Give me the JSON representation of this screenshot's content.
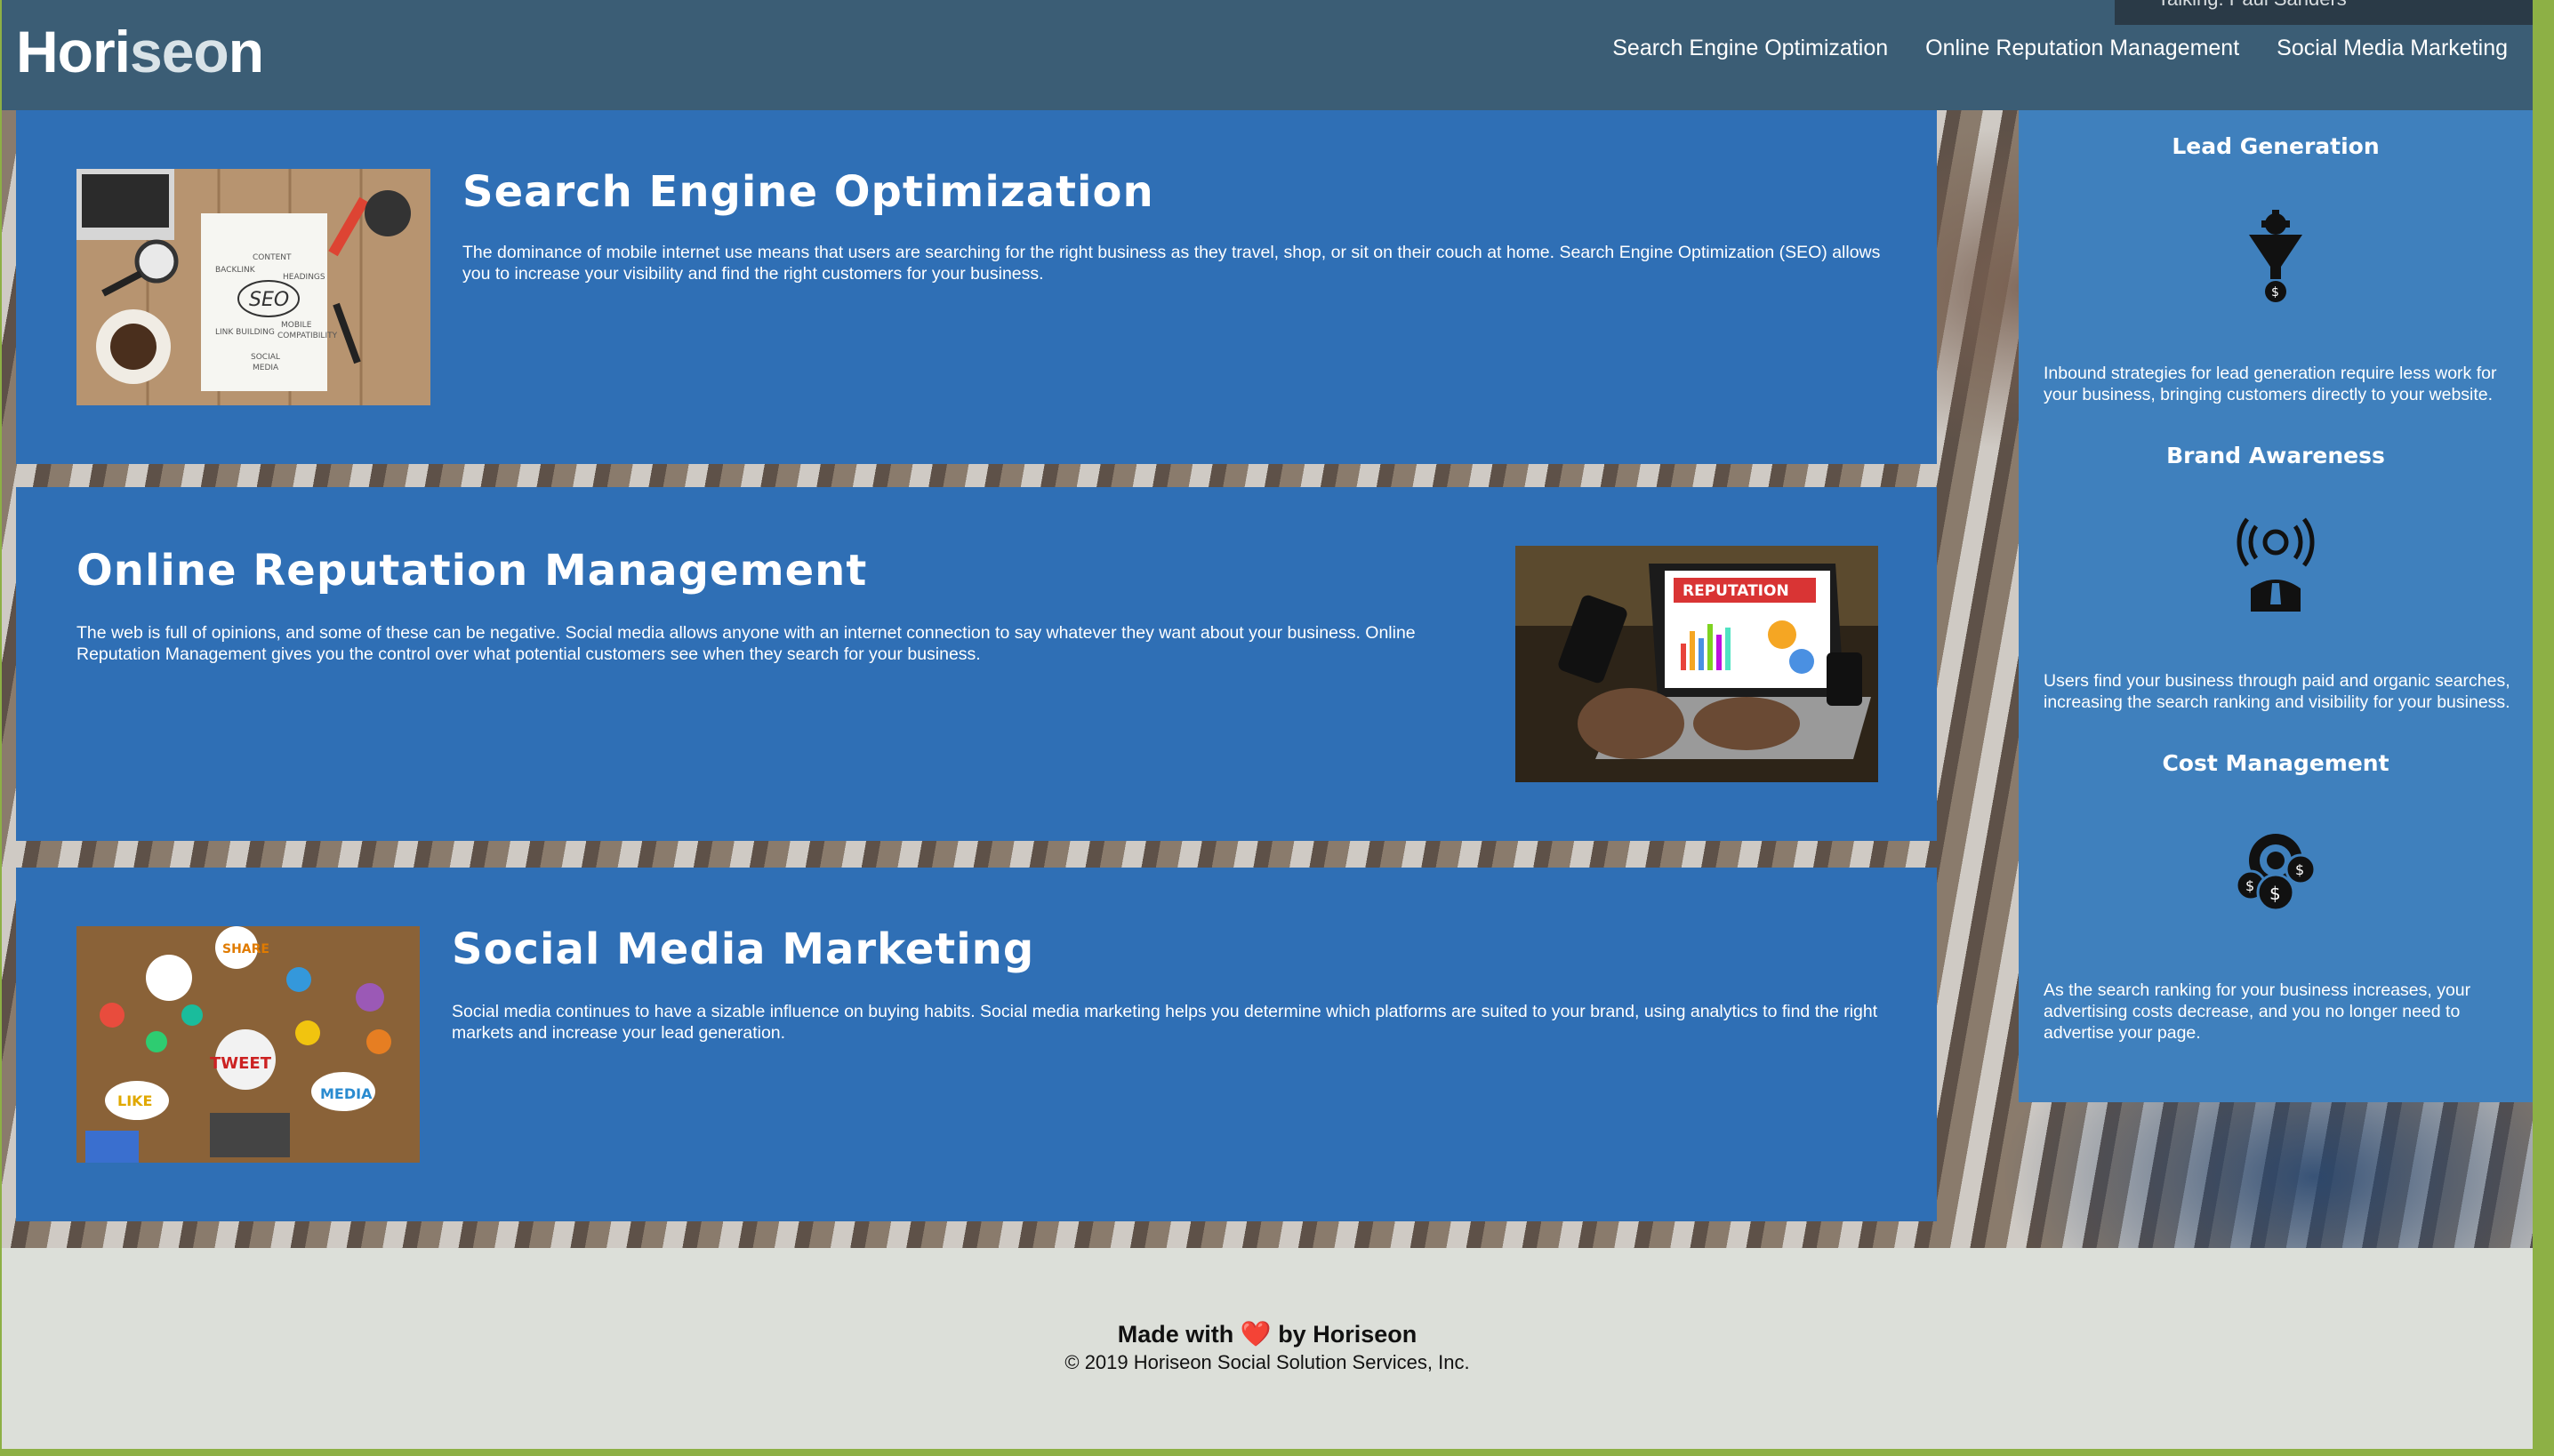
{
  "header": {
    "logo_prefix": "Hori",
    "logo_highlight": "seo",
    "logo_suffix": "n",
    "nav": [
      {
        "label": "Search Engine Optimization"
      },
      {
        "label": "Online Reputation Management"
      },
      {
        "label": "Social Media Marketing"
      }
    ],
    "tooltip": "Talking: Paul Sanders"
  },
  "sections": [
    {
      "title": "Search Engine Optimization",
      "text": "The dominance of mobile internet use means that users are searching for the right business as they travel, shop, or sit on their couch at home. Search Engine Optimization (SEO) allows you to increase your visibility and find the right customers for your business.",
      "image_words": [
        "SEO",
        "CONTENT",
        "HEADINGS",
        "BACKLINK",
        "LINK BUILDING",
        "MOBILE COMPATIBILITY",
        "SOCIAL MEDIA"
      ]
    },
    {
      "title": "Online Reputation Management",
      "text": "The web is full of opinions, and some of these can be negative. Social media allows anyone with an internet connection to say whatever they want about your business. Online Reputation Management gives you the control over what potential customers see when they search for your business.",
      "image_words": [
        "REPUTATION"
      ]
    },
    {
      "title": "Social Media Marketing",
      "text": "Social media continues to have a sizable influence on buying habits. Social media marketing helps you determine which platforms are suited to your brand, using analytics to find the right markets and increase your lead generation.",
      "image_words": [
        "SHARE",
        "TWEET",
        "LIKE",
        "MEDIA"
      ]
    }
  ],
  "benefits": [
    {
      "title": "Lead Generation",
      "icon": "lead-generation-icon",
      "text": "Inbound strategies for lead generation require less work for your business, bringing customers directly to your website."
    },
    {
      "title": "Brand Awareness",
      "icon": "brand-awareness-icon",
      "text": "Users find your business through paid and organic searches, increasing the search ranking and visibility for your business."
    },
    {
      "title": "Cost Management",
      "icon": "cost-management-icon",
      "text": "As the search ranking for your business increases, your advertising costs decrease, and you no longer need to advertise your page."
    }
  ],
  "footer": {
    "made_prefix": "Made with",
    "heart": "❤️",
    "made_suffix": "by Horiseon",
    "copyright": "© 2019 Horiseon Social Solution Services, Inc."
  },
  "colors": {
    "header_bg": "#3b5d75",
    "card_bg": "#2f6fb5",
    "aside_bg": "#3f80bd",
    "footer_bg": "#dcdfd9",
    "page_border": "#8db045"
  }
}
